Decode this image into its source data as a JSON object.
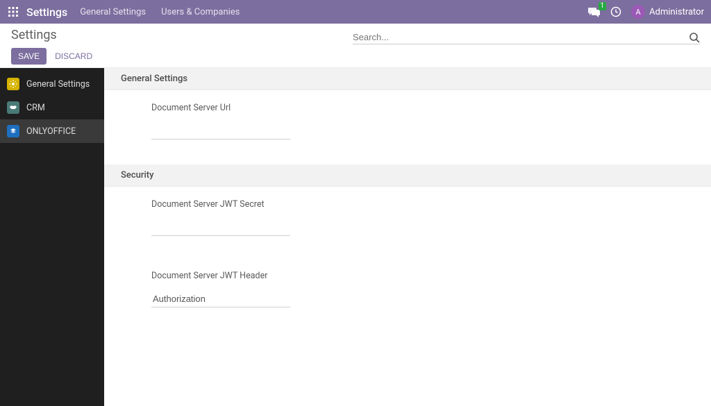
{
  "topbar": {
    "brand": "Settings",
    "nav": {
      "general": "General Settings",
      "users": "Users & Companies"
    },
    "messages_badge": "1",
    "user": {
      "initial": "A",
      "name": "Administrator"
    }
  },
  "subheader": {
    "title": "Settings",
    "save_label": "SAVE",
    "discard_label": "DISCARD",
    "search_placeholder": "Search..."
  },
  "sidebar": {
    "general": "General Settings",
    "crm": "CRM",
    "onlyoffice": "ONLYOFFICE"
  },
  "sections": {
    "general": {
      "title": "General Settings",
      "doc_url_label": "Document Server Url",
      "doc_url_value": ""
    },
    "security": {
      "title": "Security",
      "jwt_secret_label": "Document Server JWT Secret",
      "jwt_secret_value": "",
      "jwt_header_label": "Document Server JWT Header",
      "jwt_header_value": "Authorization"
    }
  }
}
